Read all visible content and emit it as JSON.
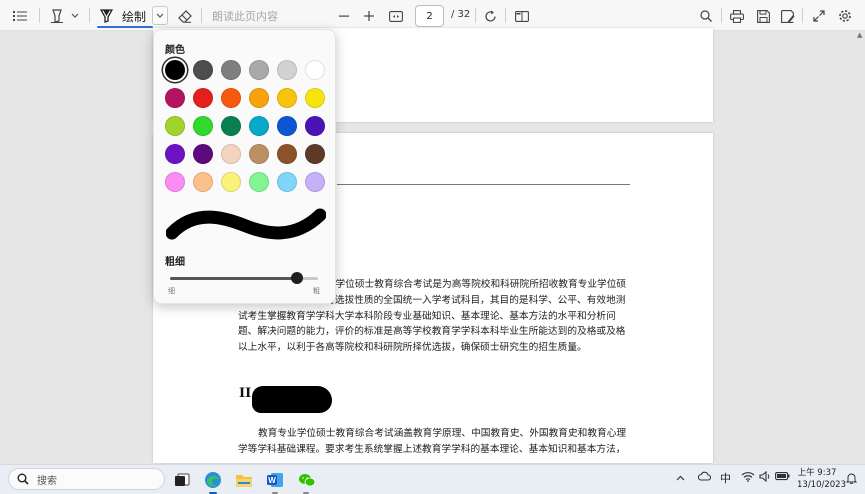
{
  "toolbar": {
    "draw_label": "绘制",
    "read_aloud_label": "朗读此页内容",
    "page_current": "2",
    "page_total": "/ 32"
  },
  "document": {
    "para1": "考试大纲教育专业学位硕士教育综合考试是为高等院校和科研院所招收教育专业学位硕士研究生而设置的具有选拔性质的全国统一入学考试科目，其目的是科学、公平、有效地测试考生掌握教育学学科大学本科阶段专业基础知识、基本理论、基本方法的水平和分析问题、解决问题的能力，评价的标准是高等学校教育学学科本科毕业生所能达到的及格或及格以上水平，以利于各高等院校和科研院所择优选拔，确保硕士研究生的招生质量。",
    "heading": "II",
    "para2": "教育专业学位硕士教育综合考试涵盖教育学原理、中国教育史、外国教育史和教育心理学等学科基础课程。要求考生系统掌握上述教育学学科的基本理论、基本知识和基本方法，"
  },
  "popup": {
    "color_title": "颜色",
    "colors": [
      "#000000",
      "#4d4d4d",
      "#7f7f7f",
      "#a9a9a9",
      "#d2d2d2",
      "#ffffff",
      "#b3135f",
      "#e3201c",
      "#f55a0f",
      "#f7a30b",
      "#f8c30d",
      "#f7e40f",
      "#a1d42a",
      "#30d92b",
      "#0a7f4f",
      "#08a8c8",
      "#0c56d6",
      "#4a13b5",
      "#6d12c4",
      "#5c0a7d",
      "#f5d3c1",
      "#bd8f65",
      "#8c5229",
      "#5d3a28",
      "#fb8cf5",
      "#fcc18b",
      "#fbf27c",
      "#82f494",
      "#7fd6f9",
      "#c5b0fa"
    ],
    "selected_color": "#000000",
    "thickness_title": "粗细",
    "thin_label": "细",
    "thick_label": "粗",
    "thickness_fraction": 0.86
  },
  "taskbar": {
    "search_placeholder": "搜索",
    "ime": "中",
    "time": "上午 9:37",
    "date": "13/10/2023"
  }
}
